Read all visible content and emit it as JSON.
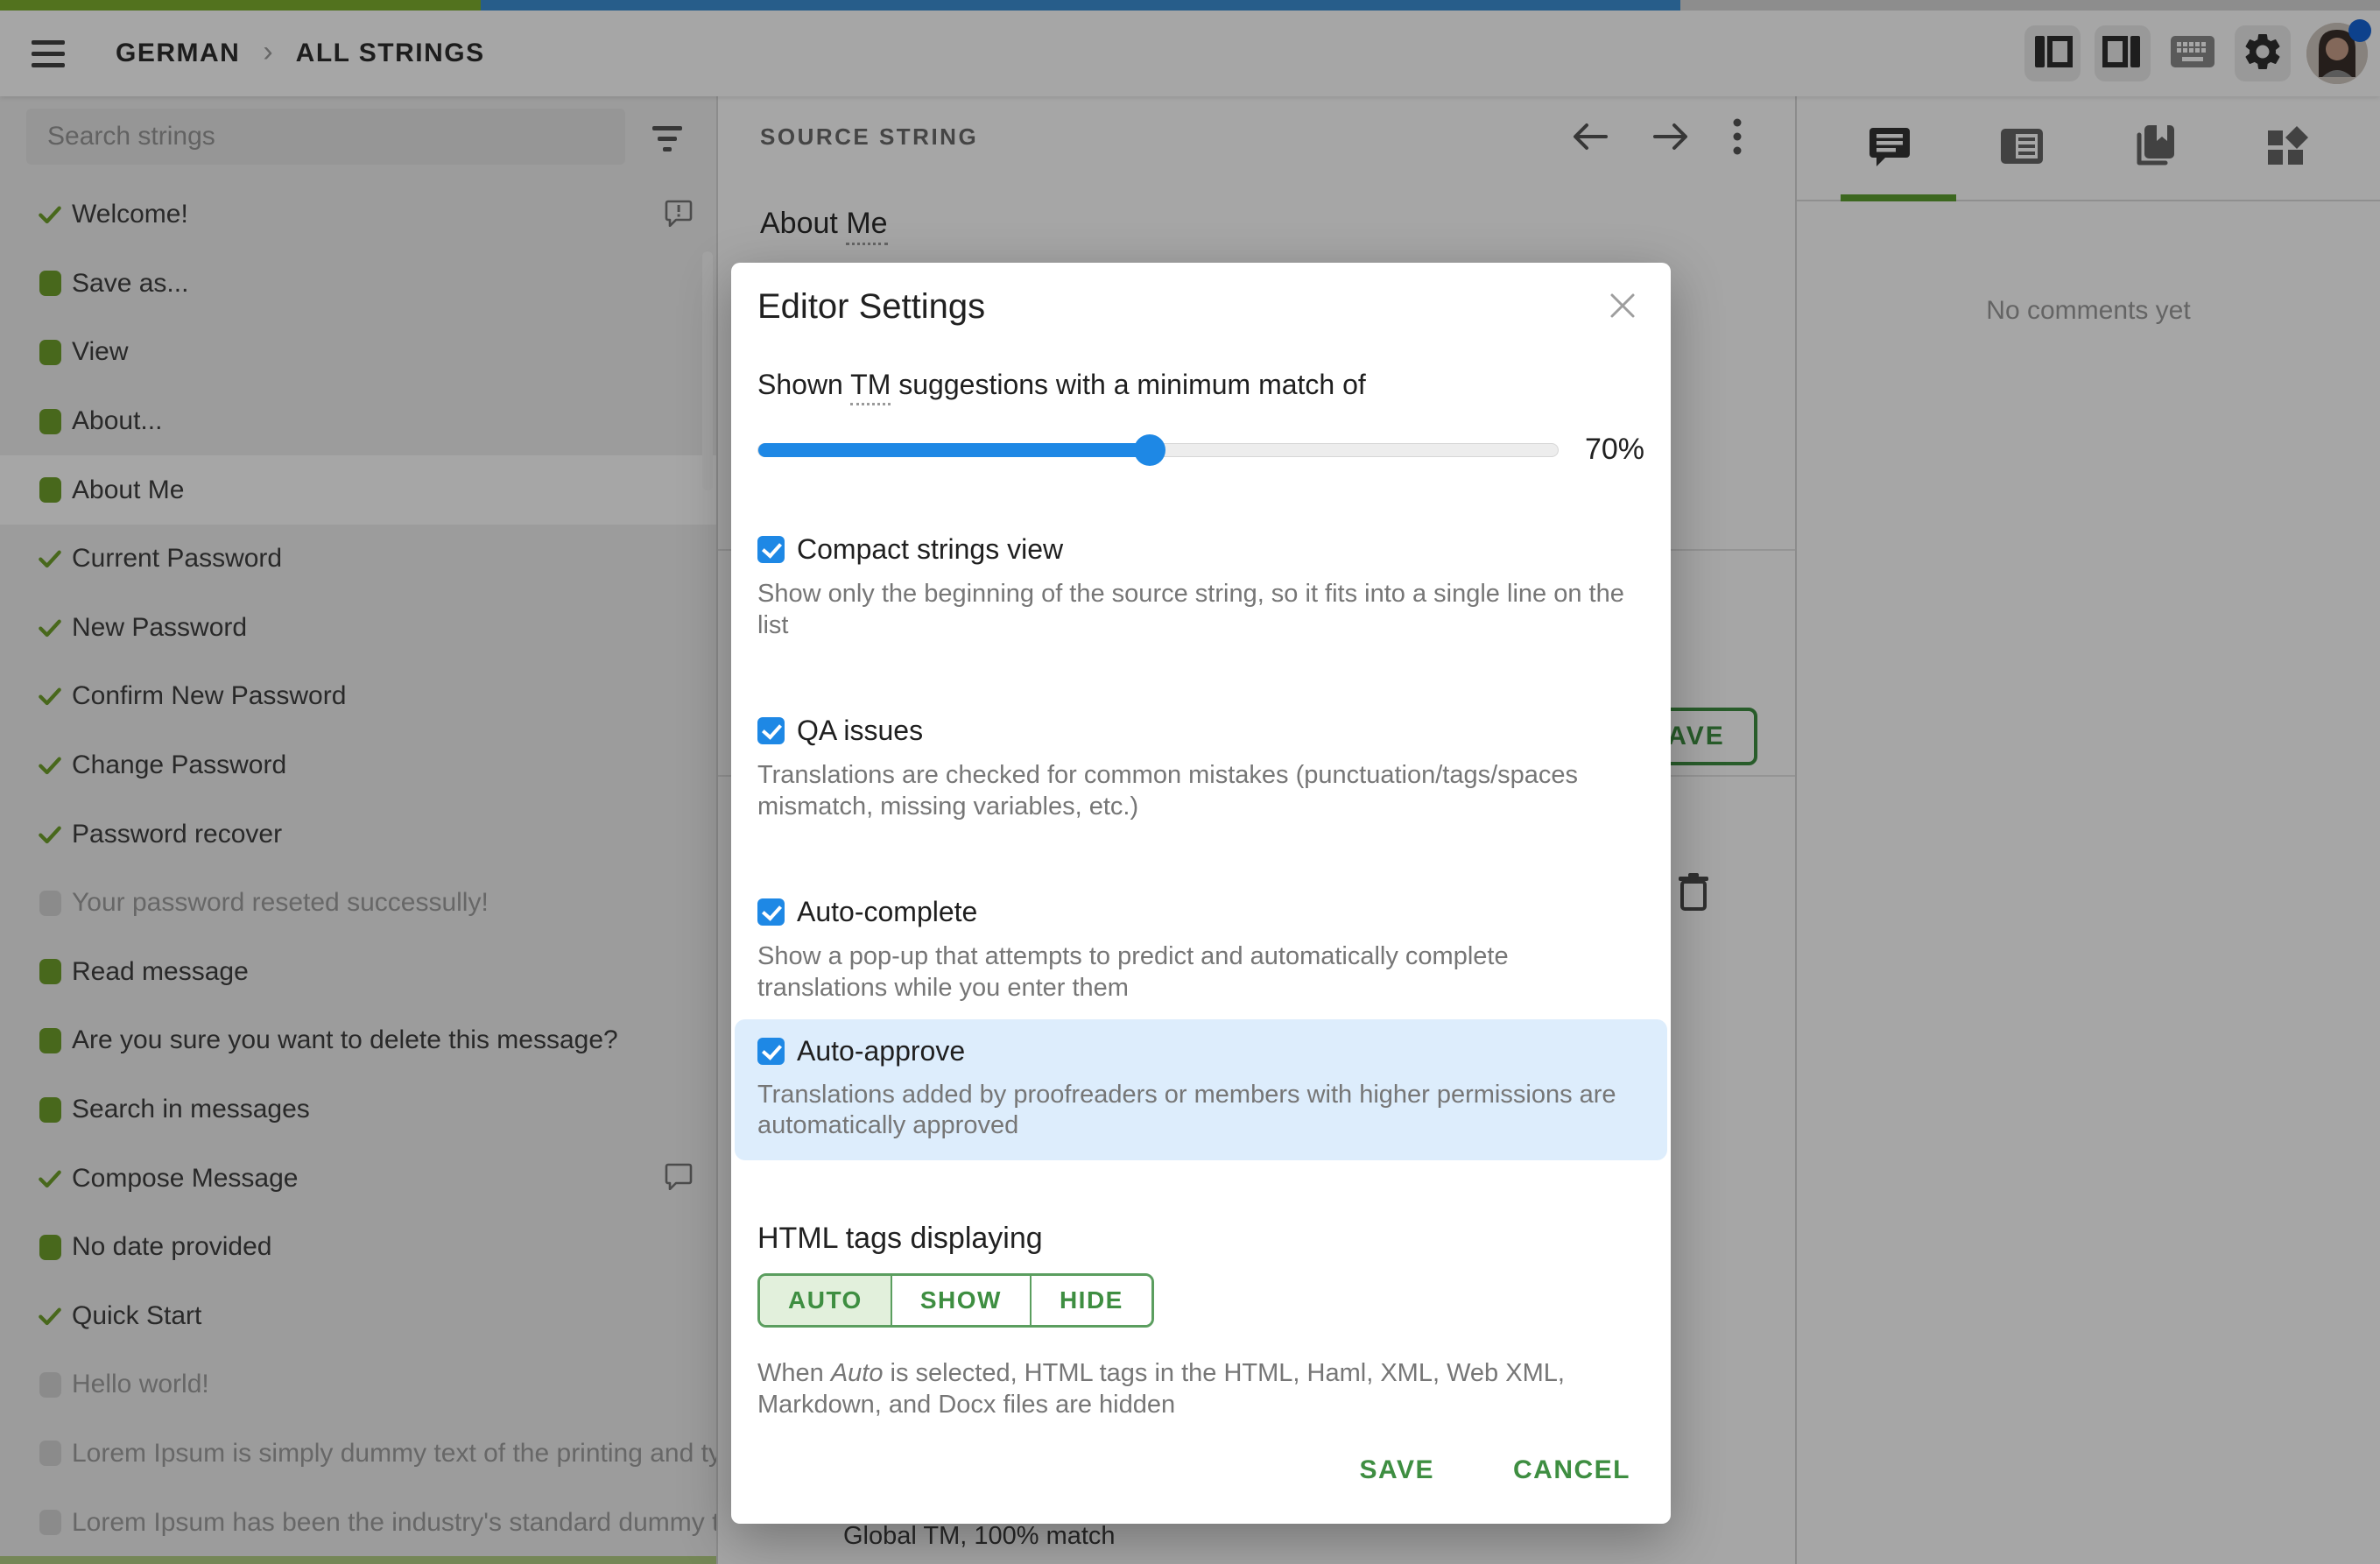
{
  "header": {
    "breadcrumb": {
      "project": "GERMAN",
      "section": "ALL STRINGS"
    },
    "progress": {
      "approved_pct": 20.2,
      "translated_pct": 50.4,
      "approved_color": "#7fb02f",
      "translated_color": "#3c8fd4"
    }
  },
  "sidebar": {
    "search_placeholder": "Search strings",
    "items": [
      {
        "label": "Welcome!",
        "status": "approved",
        "comment": "warning"
      },
      {
        "label": "Save as...",
        "status": "translated"
      },
      {
        "label": "View",
        "status": "translated"
      },
      {
        "label": "About...",
        "status": "translated"
      },
      {
        "label": "About Me",
        "status": "translated",
        "selected": true
      },
      {
        "label": "Current Password",
        "status": "approved"
      },
      {
        "label": "New Password",
        "status": "approved"
      },
      {
        "label": "Confirm New Password",
        "status": "approved"
      },
      {
        "label": "Change Password",
        "status": "approved"
      },
      {
        "label": "Password recover",
        "status": "approved"
      },
      {
        "label": "Your password reseted successully!",
        "status": "untranslated",
        "muted": true
      },
      {
        "label": "Read message",
        "status": "translated"
      },
      {
        "label": "Are you sure you want to delete this message?",
        "status": "translated"
      },
      {
        "label": "Search in messages",
        "status": "translated"
      },
      {
        "label": "Compose Message",
        "status": "approved",
        "comment": "plain"
      },
      {
        "label": "No date provided",
        "status": "translated"
      },
      {
        "label": "Quick Start",
        "status": "approved"
      },
      {
        "label": "Hello world!",
        "status": "untranslated",
        "muted": true
      },
      {
        "label": "Lorem Ipsum is simply dummy text of the printing and ty…",
        "status": "untranslated",
        "muted": true
      },
      {
        "label": "Lorem Ipsum has been the industry's standard dummy t…",
        "status": "untranslated",
        "muted": true
      }
    ]
  },
  "main": {
    "source_label": "SOURCE STRING",
    "source_text_prefix": "About ",
    "source_text_underlined": "Me",
    "save_button": "SAVE",
    "tm_match": "Global TM, 100% match"
  },
  "right_panel": {
    "empty_message": "No comments yet",
    "tabs": [
      "comments",
      "tm-suggestions",
      "glossary",
      "machine-translation"
    ]
  },
  "modal": {
    "title": "Editor Settings",
    "tm_sentence": {
      "prefix": "Shown ",
      "term": "TM",
      "suffix": " suggestions with a minimum match of"
    },
    "slider": {
      "value_label": "70%",
      "fill_pct": 49
    },
    "checkboxes": [
      {
        "label": "Compact strings view",
        "desc": "Show only the beginning of the source string, so it fits into a single line on the list",
        "checked": true,
        "highlighted": false
      },
      {
        "label": "QA issues",
        "desc": "Translations are checked for common mistakes (punctuation/tags/spaces mismatch, missing variables, etc.)",
        "checked": true,
        "highlighted": false
      },
      {
        "label": "Auto-complete",
        "desc": "Show a pop-up that attempts to predict and automatically complete translations while you enter them",
        "checked": true,
        "highlighted": false
      },
      {
        "label": "Auto-approve",
        "desc": "Translations added by proofreaders or members with higher permissions are automatically approved",
        "checked": true,
        "highlighted": true
      }
    ],
    "html_tags": {
      "heading": "HTML tags displaying",
      "options": [
        "AUTO",
        "SHOW",
        "HIDE"
      ],
      "selected": "AUTO",
      "desc_prefix": "When ",
      "desc_italic": "Auto",
      "desc_suffix": " is selected, HTML tags in the HTML, Haml, XML, Web XML, Markdown, and Docx files are hidden"
    },
    "save_label": "SAVE",
    "cancel_label": "CANCEL",
    "accent_blue": "#1e88e5",
    "accent_green": "#3e8e41",
    "highlight_bg": "#ddedfc"
  },
  "icons": {
    "hamburger": "three-bars",
    "filter": "filter-list",
    "left-panel": "layout-left",
    "right-panel": "layout-right",
    "keyboard": "keyboard",
    "settings": "gear",
    "close": "x",
    "prev": "arrow-left",
    "next": "arrow-right",
    "more": "kebab-vertical",
    "trash": "trash-outline",
    "comment": "speech-bubble",
    "comment-warning": "speech-bubble-exclamation"
  }
}
